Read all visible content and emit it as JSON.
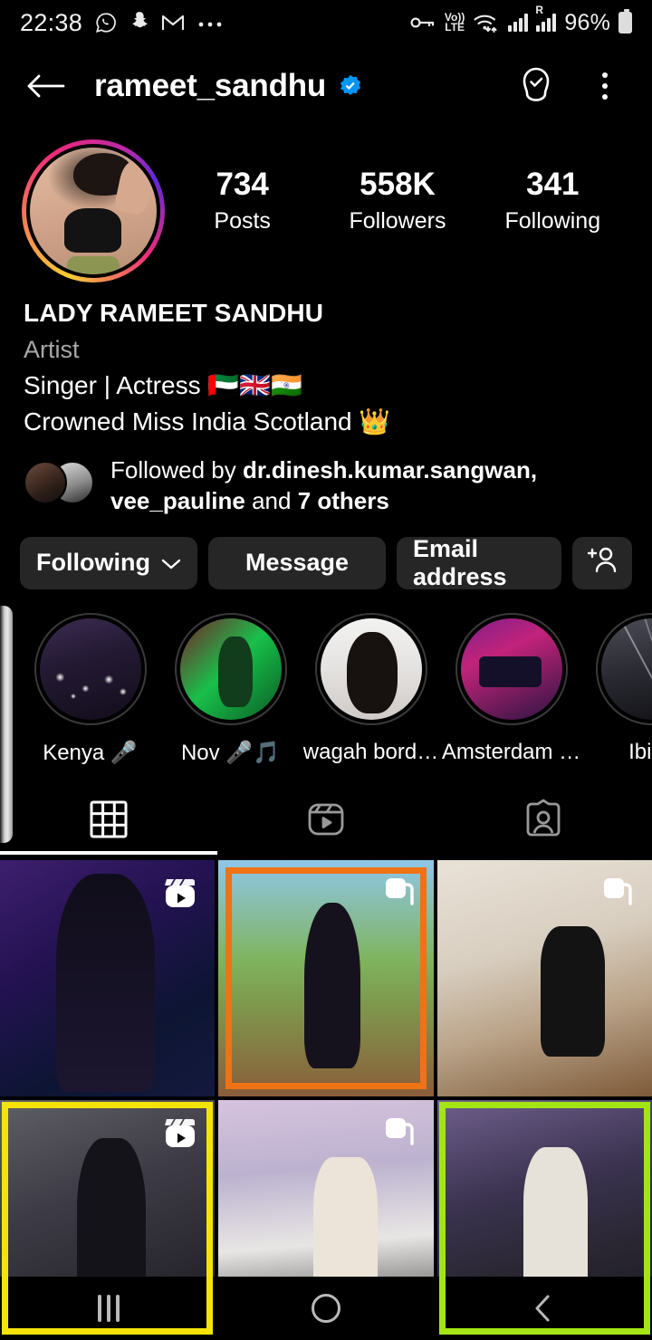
{
  "status_bar": {
    "time": "22:38",
    "icons": [
      "whatsapp-icon",
      "snapchat-icon",
      "gmail-icon",
      "more-dots-icon"
    ],
    "network_label": "LTE",
    "volte_label": "Vo))",
    "roaming_label": "R",
    "battery_percent": "96%"
  },
  "top_nav": {
    "back_icon": "back-arrow-icon",
    "username": "rameet_sandhu",
    "verified_icon": "verified-badge-icon",
    "notify_icon": "notification-bell-icon",
    "menu_icon": "kebab-menu-icon"
  },
  "profile": {
    "avatar_alt": "profile-picture",
    "stats": [
      {
        "value": "734",
        "label": "Posts"
      },
      {
        "value": "558K",
        "label": "Followers"
      },
      {
        "value": "341",
        "label": "Following"
      }
    ],
    "display_name": "LADY RAMEET SANDHU",
    "category": "Artist",
    "bio_lines": [
      "Singer | Actress 🇦🇪🇬🇧🇮🇳",
      "Crowned Miss India Scotland 👑"
    ],
    "followed_by": {
      "prefix": "Followed by ",
      "names": "dr.dinesh.kumar.sangwan, vee_pauline",
      "suffix_a": " and ",
      "suffix_count": "7 others"
    }
  },
  "actions": {
    "following_label": "Following",
    "following_chevron": "chevron-down-icon",
    "message_label": "Message",
    "email_label": "Email address",
    "add_person_icon": "add-person-icon"
  },
  "highlights": [
    {
      "label": "Kenya 🎤",
      "thumb": "thumb-kenya"
    },
    {
      "label": "Nov 🎤🎵",
      "thumb": "thumb-nov"
    },
    {
      "label": "wagah bord…",
      "thumb": "thumb-wagah"
    },
    {
      "label": "Amsterdam …",
      "thumb": "thumb-ams"
    },
    {
      "label": "Ibiza",
      "thumb": "thumb-ibiza"
    }
  ],
  "tabs": [
    {
      "name": "grid-tab",
      "icon": "grid-icon",
      "active": true
    },
    {
      "name": "reels-tab",
      "icon": "reels-icon",
      "active": false
    },
    {
      "name": "tagged-tab",
      "icon": "tagged-icon",
      "active": false
    }
  ],
  "grid": [
    {
      "art": "a1",
      "badge": "reels-icon",
      "selection": "none"
    },
    {
      "art": "a2",
      "badge": "carousel-icon",
      "selection": "orange"
    },
    {
      "art": "a3",
      "badge": "carousel-icon",
      "selection": "none"
    },
    {
      "art": "a4",
      "badge": "reels-icon",
      "selection": "yellow"
    },
    {
      "art": "a5",
      "badge": "carousel-icon",
      "selection": "none"
    },
    {
      "art": "a6",
      "badge": "none",
      "selection": "green"
    }
  ],
  "colors": {
    "selection_orange": "#ef7215",
    "selection_yellow": "#f4e308",
    "selection_green": "#a3e514",
    "verified_blue": "#0095f6",
    "button_grey": "#262626",
    "muted_text": "#a8a8a8",
    "background": "#000000"
  },
  "system_nav": {
    "recents_icon": "recents-icon",
    "home_icon": "home-icon",
    "back_icon": "system-back-icon"
  }
}
